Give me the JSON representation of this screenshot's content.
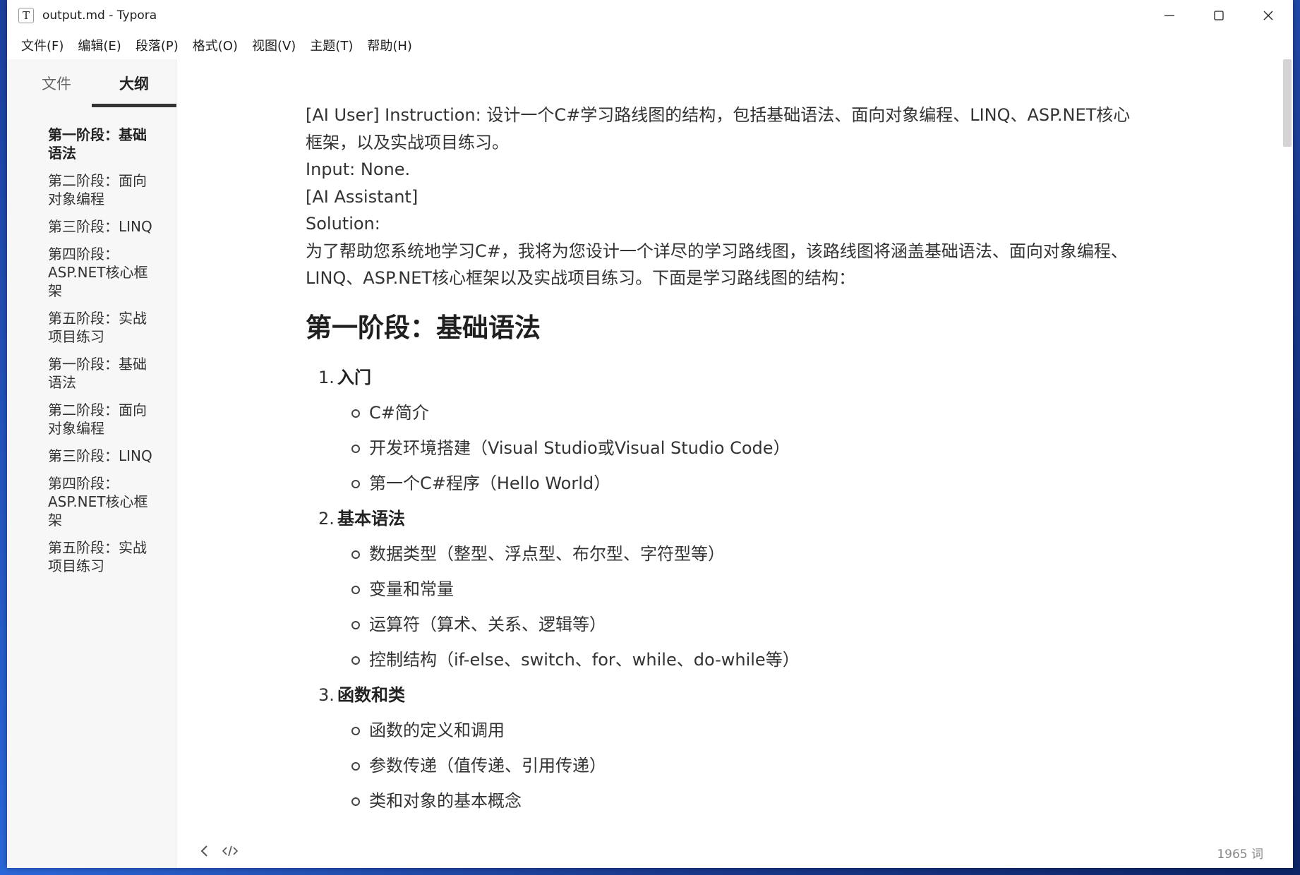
{
  "window": {
    "title": "output.md - Typora",
    "app_icon_glyph": "T"
  },
  "menu": [
    "文件(F)",
    "编辑(E)",
    "段落(P)",
    "格式(O)",
    "视图(V)",
    "主题(T)",
    "帮助(H)"
  ],
  "sidebar": {
    "tabs": {
      "files": "文件",
      "outline": "大纲"
    },
    "outline": [
      "第一阶段：基础语法",
      "第二阶段：面向对象编程",
      "第三阶段：LINQ",
      "第四阶段：ASP.NET核心框架",
      "第五阶段：实战项目练习",
      "第一阶段：基础语法",
      "第二阶段：面向对象编程",
      "第三阶段：LINQ",
      "第四阶段：ASP.NET核心框架",
      "第五阶段：实战项目练习"
    ]
  },
  "document": {
    "paragraphs": [
      "[AI User] Instruction: 设计一个C#学习路线图的结构，包括基础语法、面向对象编程、LINQ、ASP.NET核心框架，以及实战项目练习。",
      "Input: None.",
      "[AI Assistant]",
      "Solution:",
      "为了帮助您系统地学习C#，我将为您设计一个详尽的学习路线图，该路线图将涵盖基础语法、面向对象编程、LINQ、ASP.NET核心框架以及实战项目练习。下面是学习路线图的结构："
    ],
    "heading": "第一阶段：基础语法",
    "sections": [
      {
        "num": "1.",
        "title": "入门",
        "items": [
          "C#简介",
          "开发环境搭建（Visual Studio或Visual Studio Code）",
          "第一个C#程序（Hello World）"
        ]
      },
      {
        "num": "2.",
        "title": "基本语法",
        "items": [
          "数据类型（整型、浮点型、布尔型、字符型等）",
          "变量和常量",
          "运算符（算术、关系、逻辑等）",
          "控制结构（if-else、switch、for、while、do-while等）"
        ]
      },
      {
        "num": "3.",
        "title": "函数和类",
        "items": [
          "函数的定义和调用",
          "参数传递（值传递、引用传递）",
          "类和对象的基本概念"
        ]
      }
    ]
  },
  "footer": {
    "word_count": "1965 词"
  }
}
